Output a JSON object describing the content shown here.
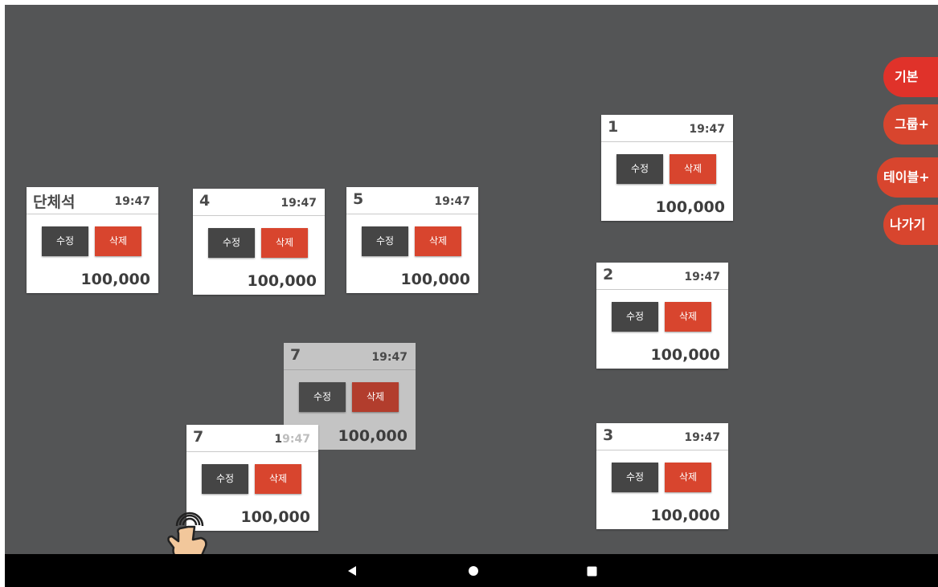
{
  "tables": [
    {
      "id": "group",
      "number": "단체석",
      "time": "19:47",
      "edit_label": "수정",
      "delete_label": "삭제",
      "price": "100,000"
    },
    {
      "id": "t4",
      "number": "4",
      "time": "19:47",
      "edit_label": "수정",
      "delete_label": "삭제",
      "price": "100,000"
    },
    {
      "id": "t5",
      "number": "5",
      "time": "19:47",
      "edit_label": "수정",
      "delete_label": "삭제",
      "price": "100,000"
    },
    {
      "id": "t1",
      "number": "1",
      "time": "19:47",
      "edit_label": "수정",
      "delete_label": "삭제",
      "price": "100,000"
    },
    {
      "id": "t2",
      "number": "2",
      "time": "19:47",
      "edit_label": "수정",
      "delete_label": "삭제",
      "price": "100,000"
    },
    {
      "id": "t3",
      "number": "3",
      "time": "19:47",
      "edit_label": "수정",
      "delete_label": "삭제",
      "price": "100,000"
    },
    {
      "id": "t7_original",
      "number": "7",
      "time": "19:47",
      "edit_label": "수정",
      "delete_label": "삭제",
      "price": "100,000"
    },
    {
      "id": "t7_dragging",
      "number": "7",
      "time_prefix": "1",
      "time_rest": "9:47",
      "edit_label": "수정",
      "delete_label": "삭제",
      "price": "100,000"
    }
  ],
  "side_menu": [
    {
      "label": "기본",
      "color": "#e0322a"
    },
    {
      "label": "그룹+",
      "color": "#d8452e"
    },
    {
      "label": "테이블+",
      "color": "#d8452e"
    },
    {
      "label": "나가기",
      "color": "#d8452e"
    }
  ],
  "nav": {
    "back_icon": "back-triangle-icon",
    "home_icon": "home-circle-icon",
    "recents_icon": "recents-square-icon"
  },
  "gesture_icon": "tap-hand-icon"
}
